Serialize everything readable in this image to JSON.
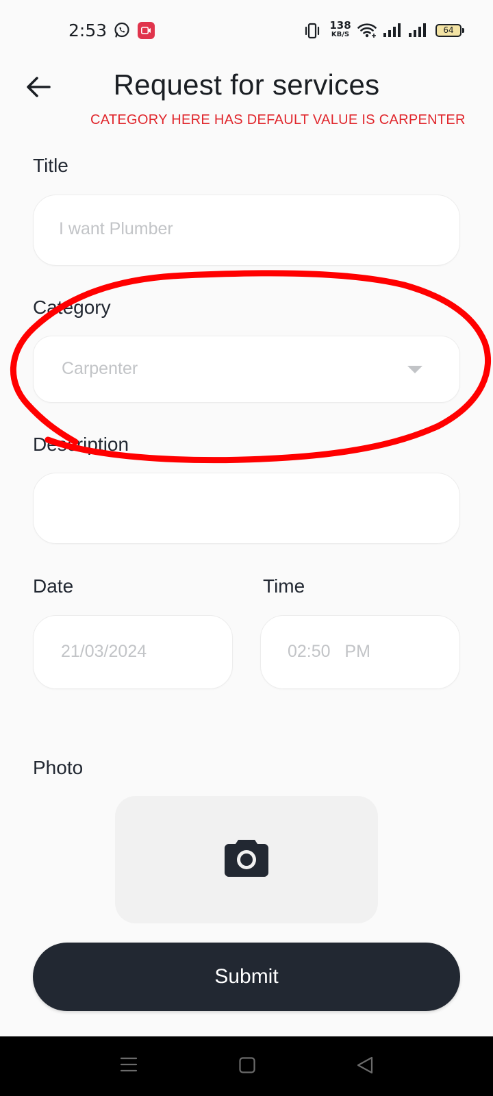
{
  "status_bar": {
    "time": "2:53",
    "net_speed_value": "138",
    "net_speed_unit": "KB/S",
    "battery": "64",
    "icons": [
      "whatsapp-icon",
      "screen-record-icon",
      "vibrate-icon",
      "wifi-icon",
      "signal-icon",
      "signal-icon",
      "battery-icon"
    ]
  },
  "header": {
    "title": "Request for services",
    "back_icon": "arrow-left-icon"
  },
  "annotation": {
    "note": "CATEGORY HERE HAS DEFAULT VALUE IS CARPENTER",
    "color": "#e0262c"
  },
  "form": {
    "title_label": "Title",
    "title_placeholder": "I want Plumber",
    "category_label": "Category",
    "category_value": "Carpenter",
    "description_label": "Description",
    "description_value": "",
    "date_label": "Date",
    "date_value": "21/03/2024",
    "time_label": "Time",
    "time_value": "02:50   PM",
    "photo_label": "Photo",
    "photo_icon": "camera-icon",
    "submit_label": "Submit"
  },
  "nav_bar": {
    "icons": [
      "menu-icon",
      "home-icon",
      "back-triangle-icon"
    ]
  },
  "colors": {
    "primary": "#222832",
    "background": "#fafafa",
    "placeholder": "#c2c4c7",
    "annotation": "#e0262c"
  }
}
